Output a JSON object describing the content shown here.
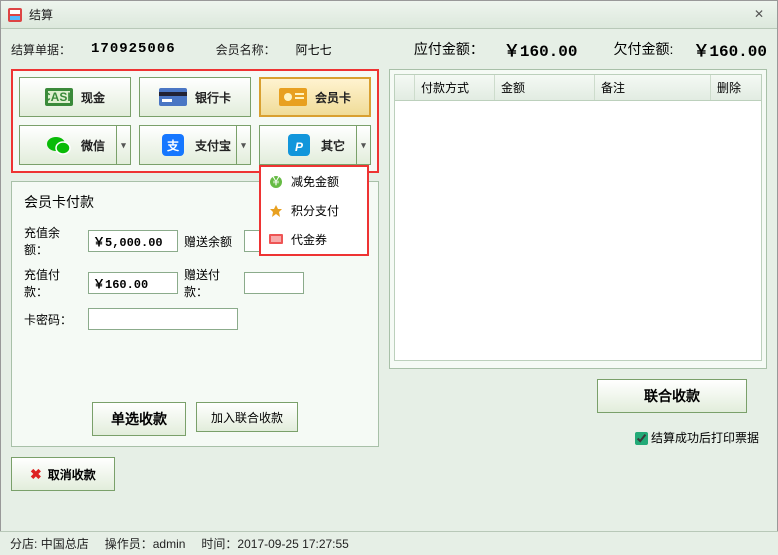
{
  "window": {
    "title": "结算"
  },
  "header": {
    "orderNoLabel": "结算单据：",
    "orderNo": "170925006",
    "memberLabel": "会员名称：",
    "memberName": "阿七七",
    "dueLabel": "应付金额：",
    "dueAmount": "￥160.00",
    "owedLabel": "欠付金额:",
    "owedAmount": "￥160.00"
  },
  "payMethods": {
    "cash": "现金",
    "bank": "银行卡",
    "member": "会员卡",
    "wechat": "微信",
    "alipay": "支付宝",
    "other": "其它"
  },
  "otherMenu": {
    "discount": "减免金额",
    "points": "积分支付",
    "voucher": "代金券"
  },
  "memberPay": {
    "title": "会员卡付款",
    "balanceLabel": "充值余额：",
    "balanceValue": "￥5,000.00",
    "bonusBalanceLabel": "赠送余额",
    "bonusBalanceValue": "",
    "payLabel": "充值付款：",
    "payValue": "￥160.00",
    "bonusPayLabel": "赠送付款：",
    "bonusPayValue": "",
    "pwdLabel": "卡密码："
  },
  "actions": {
    "singleCollect": "单选收款",
    "addJoint": "加入联合收款",
    "jointCollect": "联合收款",
    "cancel": "取消收款",
    "printLabel": "结算成功后打印票据"
  },
  "table": {
    "colMethod": "付款方式",
    "colAmount": "金额",
    "colNote": "备注",
    "colDelete": "删除"
  },
  "status": {
    "storeLabel": "分店:",
    "storeName": "中国总店",
    "operatorLabel": "操作员：",
    "operatorName": "admin",
    "timeLabel": "时间：",
    "timeValue": "2017-09-25 17:27:55"
  }
}
